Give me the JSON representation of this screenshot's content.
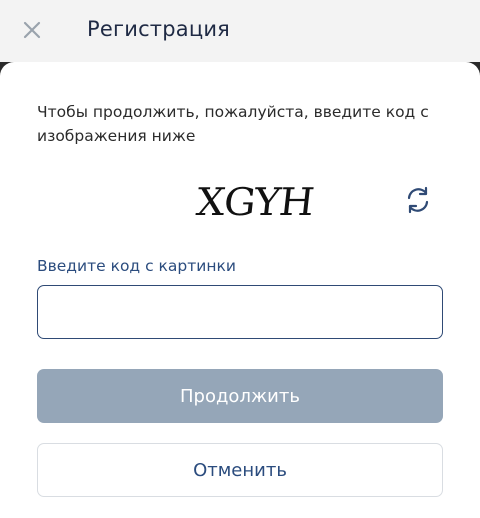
{
  "header": {
    "title": "Регистрация",
    "close_icon": "close-icon"
  },
  "main": {
    "instruction": "Чтобы продолжить, пожалуйста, введите код с изображения ниже",
    "captcha_text": "XGYH",
    "refresh_icon": "refresh-icon",
    "field_label": "Введите код с картинки",
    "input_value": "",
    "input_placeholder": "",
    "continue_label": "Продолжить",
    "cancel_label": "Отменить"
  },
  "colors": {
    "header_bg": "#f3f3f3",
    "title": "#1f2a44",
    "accent": "#2b4c7e",
    "input_border": "#2f4a75",
    "continue_bg_disabled": "#95a6b8",
    "cancel_border": "#d9dde2"
  }
}
